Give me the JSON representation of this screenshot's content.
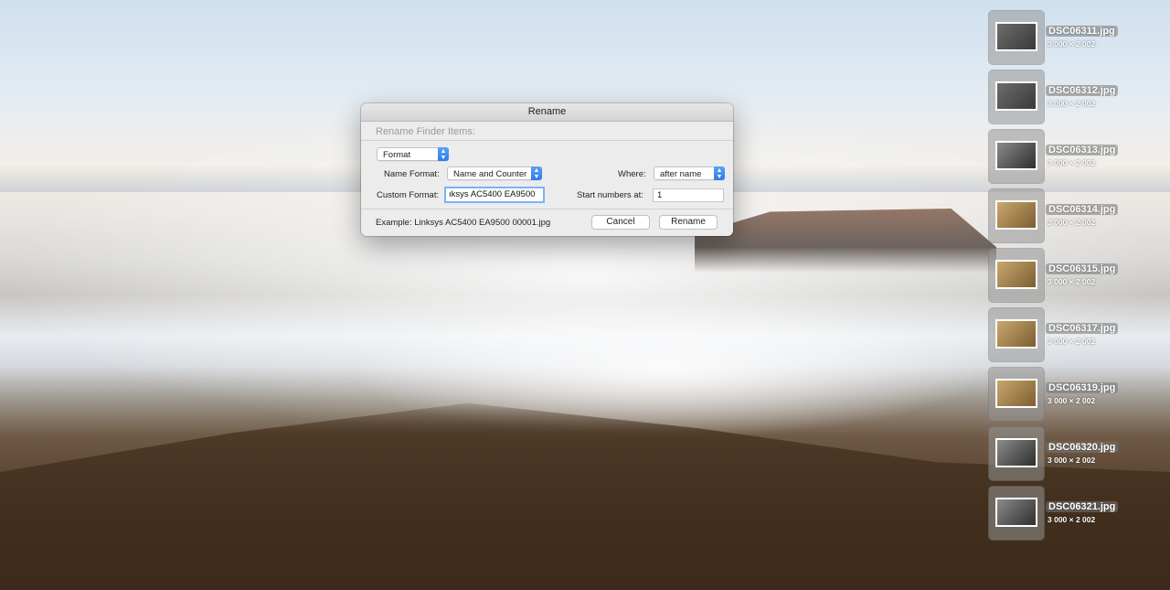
{
  "dialog": {
    "title": "Rename",
    "section_title": "Rename Finder Items:",
    "format_popup": "Format",
    "name_format_label": "Name Format:",
    "name_format_value": "Name and Counter",
    "where_label": "Where:",
    "where_value": "after name",
    "custom_format_label": "Custom Format:",
    "custom_format_value": "ıksys AC5400 EA9500",
    "start_numbers_label": "Start numbers at:",
    "start_numbers_value": "1",
    "example": "Example: Linksys AC5400 EA9500 00001.jpg",
    "cancel_label": "Cancel",
    "rename_label": "Rename"
  },
  "files": [
    {
      "name": "DSC06311.jpg",
      "dims": "3 000 × 2 002"
    },
    {
      "name": "DSC06312.jpg",
      "dims": "3 000 × 2 002"
    },
    {
      "name": "DSC06313.jpg",
      "dims": "3 000 × 2 002"
    },
    {
      "name": "DSC06314.jpg",
      "dims": "3 000 × 2 002"
    },
    {
      "name": "DSC06315.jpg",
      "dims": "3 000 × 2 002"
    },
    {
      "name": "DSC06317.jpg",
      "dims": "3 000 × 2 002"
    },
    {
      "name": "DSC06319.jpg",
      "dims": "3 000 × 2 002"
    },
    {
      "name": "DSC06320.jpg",
      "dims": "3 000 × 2 002"
    },
    {
      "name": "DSC06321.jpg",
      "dims": "3 000 × 2 002"
    }
  ],
  "colors": {
    "accent": "#2f7be8",
    "focus_ring": "#7ab2f8"
  },
  "icons": {
    "popup_arrows": "updown-chevron-icon"
  }
}
